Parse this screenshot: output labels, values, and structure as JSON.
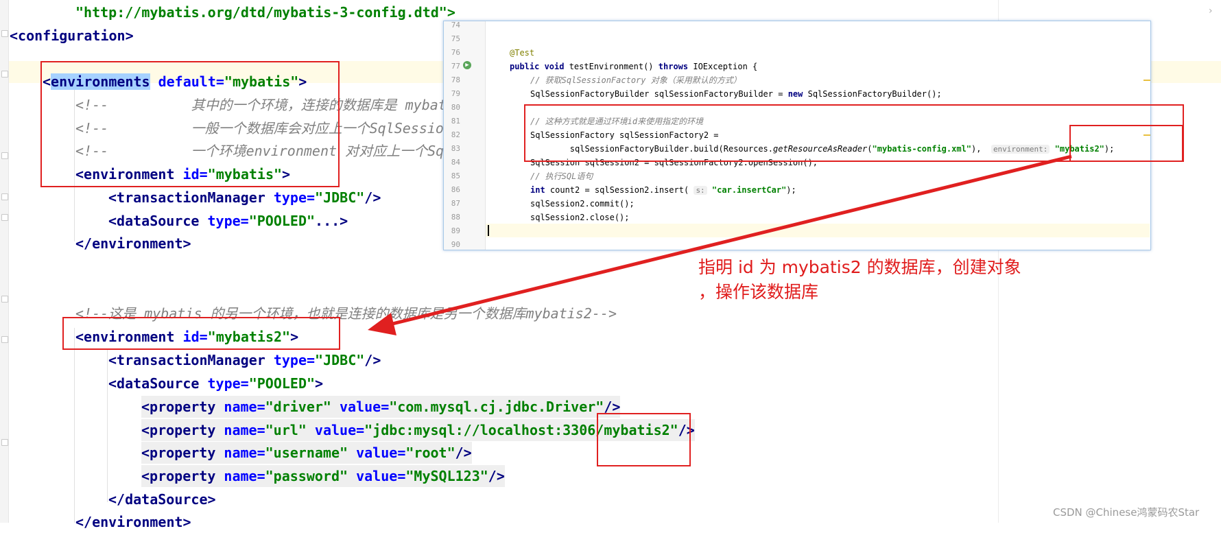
{
  "xml": {
    "line1": "\"http://mybatis.org/dtd/mybatis-3-config.dtd\">",
    "line2_tag": "<configuration>",
    "line3_open": "<",
    "line3_tag": "environments",
    "line3_attr": " default",
    "line3_eq": "=",
    "line3_val": "\"mybatis\"",
    "line3_close": ">",
    "comment1": "<!--          其中的一个环境，连接的数据库是 mybatis-->",
    "comment2": "<!--          一般一个数据库会对应上一个SqlSessionFactory对象-->",
    "comment3": "<!--          一个环境environment 对对应上一个SqlSessionFactory对象-->",
    "env1_open": "<environment",
    "env1_attr": " id",
    "env1_eq": "=",
    "env1_val": "\"mybatis\"",
    "env1_close": ">",
    "tm_open": "<transactionManager",
    "tm_attr": " type",
    "tm_eq": "=",
    "tm_val": "\"JDBC\"",
    "tm_close": "/>",
    "ds1_open": "<dataSource",
    "ds1_attr": " type",
    "ds1_eq": "=",
    "ds1_val": "\"POOLED\"",
    "ds1_close": "...>",
    "env1_end": "</environment>",
    "comment4": "<!--这是 mybatis 的另一个环境，也就是连接的数据库是另一个数据库mybatis2-->",
    "env2_open": "<environment",
    "env2_attr": " id",
    "env2_eq": "=",
    "env2_val": "\"mybatis2\"",
    "env2_close": ">",
    "tm2_open": "<transactionManager",
    "tm2_attr": " type",
    "tm2_eq": "=",
    "tm2_val": "\"JDBC\"",
    "tm2_close": "/>",
    "ds2_open": "<dataSource",
    "ds2_attr": " type",
    "ds2_eq": "=",
    "ds2_val": "\"POOLED\"",
    "ds2_close": ">",
    "properties": [
      {
        "open": "<property",
        "name_attr": " name",
        "eq1": "=",
        "name_val": "\"driver\"",
        "value_attr": " value",
        "eq2": "=",
        "value_val": "\"com.mysql.cj.jdbc.Driver\"",
        "close": "/>"
      },
      {
        "open": "<property",
        "name_attr": " name",
        "eq1": "=",
        "name_val": "\"url\"",
        "value_attr": " value",
        "eq2": "=",
        "value_val": "\"jdbc:mysql://localhost:3306/mybatis2\"",
        "close": "/>"
      },
      {
        "open": "<property",
        "name_attr": " name",
        "eq1": "=",
        "name_val": "\"username\"",
        "value_attr": " value",
        "eq2": "=",
        "value_val": "\"root\"",
        "close": "/>"
      },
      {
        "open": "<property",
        "name_attr": " name",
        "eq1": "=",
        "name_val": "\"password\"",
        "value_attr": " value",
        "eq2": "=",
        "value_val": "\"MySQL123\"",
        "close": "/>"
      }
    ],
    "ds2_end": "</dataSource>",
    "env2_end": "</environment>"
  },
  "java": {
    "line_numbers": [
      "74",
      "75",
      "76",
      "77",
      "78",
      "79",
      "80",
      "81",
      "82",
      "83",
      "84",
      "85",
      "86",
      "87",
      "88",
      "89",
      "90"
    ],
    "l76_ann": "@Test",
    "l77_kw1": "public void",
    "l77_name": " testEnvironment() ",
    "l77_kw2": "throws",
    "l77_ex": " IOException {",
    "l78": "// 获取SqlSessionFactory 对象（采用默认的方式）",
    "l79_a": "SqlSessionFactoryBuilder sqlSessionFactoryBuilder = ",
    "l79_kw": "new",
    "l79_b": " SqlSessionFactoryBuilder();",
    "l81": "// 这种方式就是通过环境id来使用指定的环境",
    "l82": "SqlSessionFactory sqlSessionFactory2 =",
    "l83_a": "        sqlSessionFactoryBuilder.build(Resources.",
    "l83_it": "getResourceAsReader",
    "l83_b": "(",
    "l83_str": "\"mybatis-config.xml\"",
    "l83_c": "),  ",
    "l83_hint": "environment:",
    "l83_sp": " ",
    "l83_str2": "\"mybatis2\"",
    "l83_d": ");",
    "l84": "SqlSession sqlSession2 = sqlSessionFactory2.openSession();",
    "l85": "// 执行SQL语句",
    "l86_kw": "int",
    "l86_a": " count2 = sqlSession2.insert( ",
    "l86_hint": "s:",
    "l86_sp": " ",
    "l86_str": "\"car.insertCar\"",
    "l86_b": ");",
    "l87": "sqlSession2.commit();",
    "l88": "sqlSession2.close();"
  },
  "annotation": {
    "line1": "指明 id 为 mybatis2 的数据库，创建对象",
    "line2": "，操作该数据库"
  },
  "watermark": "CSDN @Chinese鸿蒙码农Star",
  "colors": {
    "tag": "#000080",
    "attr": "#0000ff",
    "value": "#008000",
    "comment": "#808080",
    "highlight_box": "#e02020",
    "annotation": "#e01c1c"
  }
}
